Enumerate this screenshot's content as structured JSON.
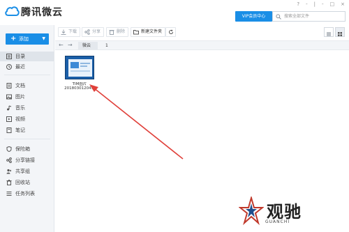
{
  "app": {
    "title": "腾讯微云",
    "vip_label": "VIP会员中心",
    "search_placeholder": "搜索全部文件",
    "window_controls": [
      "?",
      "-",
      "|",
      "-",
      "□",
      "×"
    ],
    "accent": "#1a8ee6"
  },
  "sidebar": {
    "add_label": "添加",
    "items": [
      {
        "label": "目录",
        "icon": "directory-icon",
        "active": true
      },
      {
        "label": "最近",
        "icon": "clock-icon"
      },
      {
        "label": "文档",
        "icon": "document-icon"
      },
      {
        "label": "图片",
        "icon": "image-icon"
      },
      {
        "label": "音乐",
        "icon": "music-icon"
      },
      {
        "label": "视频",
        "icon": "video-icon"
      },
      {
        "label": "笔记",
        "icon": "note-icon"
      },
      {
        "label": "保险箱",
        "icon": "shield-icon"
      },
      {
        "label": "分享链接",
        "icon": "share-link-icon"
      },
      {
        "label": "共享组",
        "icon": "group-icon"
      },
      {
        "label": "回收站",
        "icon": "trash-icon"
      },
      {
        "label": "任务列表",
        "icon": "task-list-icon"
      }
    ]
  },
  "toolbar": {
    "download": "下载",
    "share": "分享",
    "delete": "删除",
    "new_folder": "新建文件夹"
  },
  "path": {
    "crumb": "微云",
    "count": "1"
  },
  "files": [
    {
      "name_line1": "TIM图片",
      "name_line2": "20180301204..."
    }
  ],
  "watermark": {
    "text": "观驰",
    "sub": "GUANCHI"
  }
}
